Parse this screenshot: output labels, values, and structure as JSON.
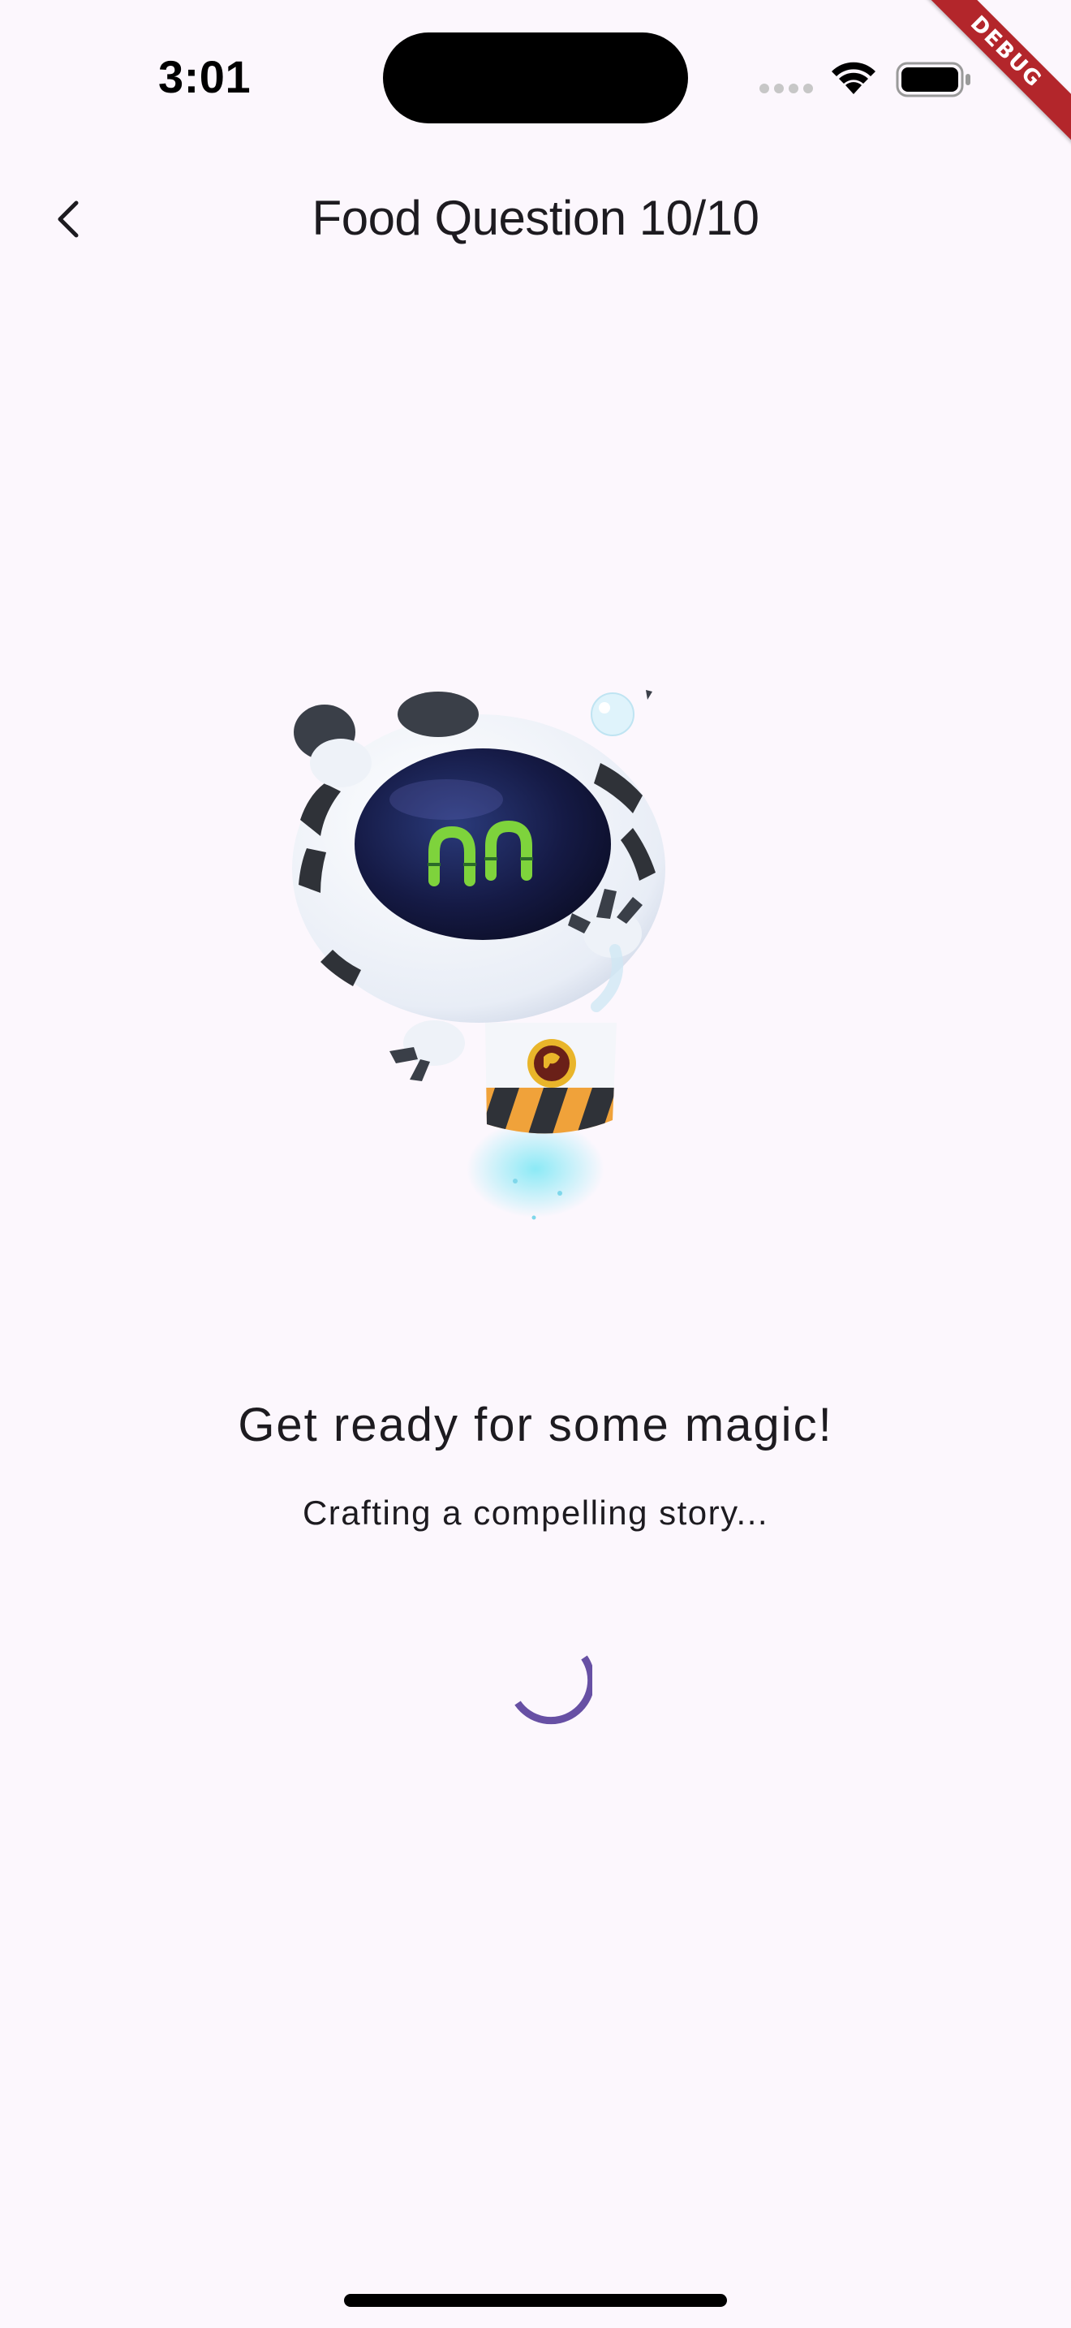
{
  "status_bar": {
    "time": "3:01",
    "icons": [
      "signal-icon",
      "wifi-icon",
      "battery-icon"
    ]
  },
  "debug_banner": {
    "label": "DEBUG",
    "color": "#b3262b"
  },
  "app_bar": {
    "back_icon": "chevron-left-icon",
    "title": "Food Question 10/10"
  },
  "mascot": {
    "description_icon": "robot-mascot-icon"
  },
  "loading": {
    "headline": "Get ready for some magic!",
    "subtitle": "Crafting a compelling story...",
    "spinner_color": "#6750a4"
  },
  "colors": {
    "background": "#fcf7fd",
    "text": "#1d1b20",
    "accent": "#6750a4"
  }
}
